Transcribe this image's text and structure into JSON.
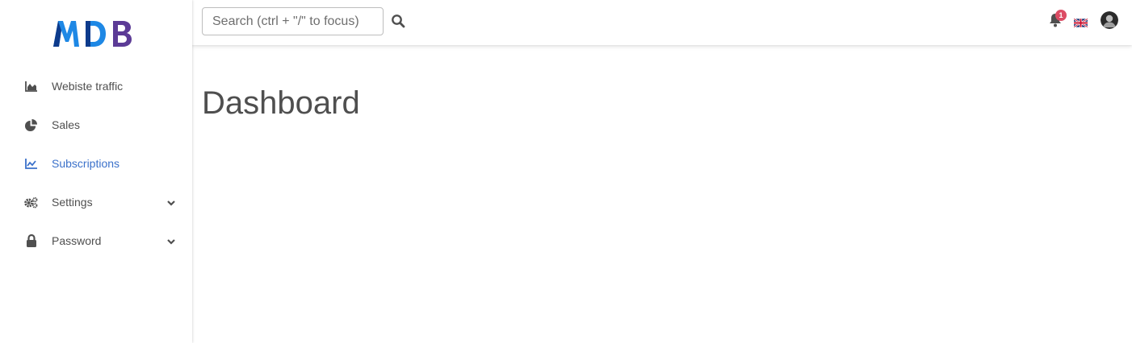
{
  "brand": {
    "logo_text": "MDB",
    "colors": {
      "blue": "#1e88e5",
      "navy": "#0d3b8c",
      "purple": "#5c3b96"
    }
  },
  "sidebar": {
    "items": [
      {
        "label": "Webiste traffic",
        "icon": "area-chart-icon",
        "active": false,
        "expandable": false
      },
      {
        "label": "Sales",
        "icon": "pie-chart-icon",
        "active": false,
        "expandable": false
      },
      {
        "label": "Subscriptions",
        "icon": "line-chart-icon",
        "active": true,
        "expandable": false
      },
      {
        "label": "Settings",
        "icon": "gears-icon",
        "active": false,
        "expandable": true
      },
      {
        "label": "Password",
        "icon": "lock-icon",
        "active": false,
        "expandable": true
      }
    ]
  },
  "navbar": {
    "search": {
      "placeholder": "Search (ctrl + \"/\" to focus)",
      "value": ""
    },
    "notifications": {
      "icon": "bell-icon",
      "count": "1"
    },
    "language": {
      "icon": "uk-flag-icon"
    },
    "user": {
      "icon": "avatar"
    }
  },
  "main": {
    "title": "Dashboard"
  },
  "colors": {
    "text": "#4f4f4f",
    "active": "#3b71ca",
    "badge": "#dc4c64",
    "border": "#bdbdbd"
  }
}
